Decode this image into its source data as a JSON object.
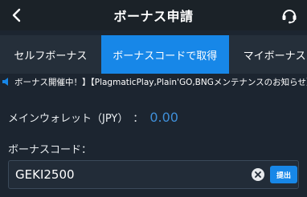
{
  "header": {
    "title": "ボーナス申請",
    "back_icon": "chevron-left-icon",
    "support_icon": "headset-icon"
  },
  "tabs": [
    {
      "label": "セルフボーナス",
      "active": false
    },
    {
      "label": "ボーナスコードで取得",
      "active": true
    },
    {
      "label": "マイボーナス",
      "active": false
    }
  ],
  "ticker": {
    "icon": "speaker-icon",
    "text": "ボーナス開催中！】【PlagmaticPlay,Plain'GO,BNGメンテナンスのお知らせ】"
  },
  "wallet": {
    "label": "メインウォレット（JPY）",
    "separator": "：",
    "value": "0.00"
  },
  "bonus_code": {
    "label": "ボーナスコード：",
    "value": "GEKI2500",
    "clear_icon": "clear-circle-icon",
    "submit_label": "提出"
  },
  "colors": {
    "background": "#1c2530",
    "header": "#1b2228",
    "tab_bar": "#252f3a",
    "accent": "#1787e8",
    "wallet_value": "#3f8fd8"
  }
}
